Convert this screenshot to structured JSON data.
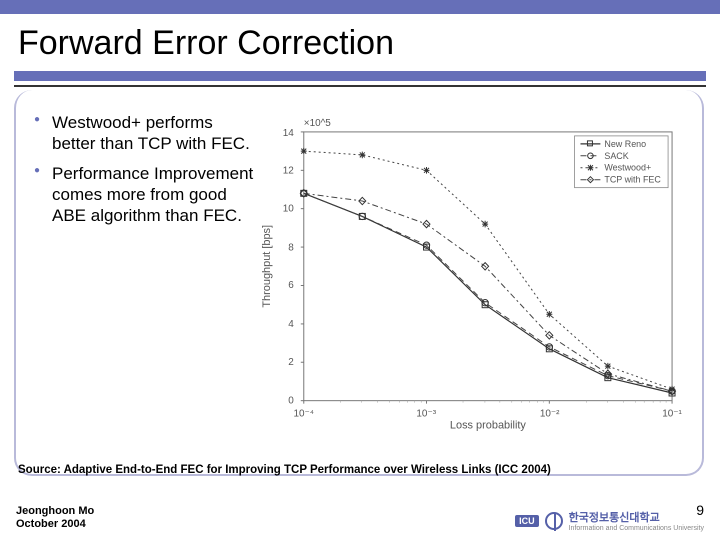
{
  "title": "Forward Error Correction",
  "bullets": [
    "Westwood+ performs better than TCP with FEC.",
    "Performance Improvement comes more from good ABE algorithm than FEC."
  ],
  "source_line": "Source: Adaptive End-to-End FEC for Improving TCP Performance over Wireless Links (ICC 2004)",
  "footer": {
    "author": "Jeonghoon Mo",
    "date": "October 2004",
    "page": "9",
    "uni_kr": "한국정보통신대학교",
    "uni_en": "Information and Communications University",
    "icu": "ICU"
  },
  "chart_data": {
    "type": "line",
    "title": "",
    "xlabel": "Loss probability",
    "ylabel": "Throughput [bps]",
    "x_scale": "log",
    "xlim": [
      0.0001,
      0.1
    ],
    "ylim": [
      0,
      14
    ],
    "y_multiplier_label": "×10^5",
    "x_ticks": [
      0.0001,
      0.001,
      0.01,
      0.1
    ],
    "x_tick_labels": [
      "10^-4",
      "10^-3",
      "10^-2",
      "10^-1"
    ],
    "y_ticks": [
      0,
      2,
      4,
      6,
      8,
      10,
      12,
      14
    ],
    "legend_position": "top-right",
    "series": [
      {
        "name": "New Reno",
        "marker": "square",
        "x": [
          0.0001,
          0.0003,
          0.001,
          0.003,
          0.01,
          0.03,
          0.1
        ],
        "y": [
          10.8,
          9.6,
          8.0,
          5.0,
          2.7,
          1.2,
          0.4
        ]
      },
      {
        "name": "SACK",
        "marker": "circle",
        "x": [
          0.0001,
          0.0003,
          0.001,
          0.003,
          0.01,
          0.03,
          0.1
        ],
        "y": [
          10.8,
          9.6,
          8.1,
          5.1,
          2.8,
          1.3,
          0.5
        ]
      },
      {
        "name": "Westwood+",
        "marker": "star",
        "x": [
          0.0001,
          0.0003,
          0.001,
          0.003,
          0.01,
          0.03,
          0.1
        ],
        "y": [
          13.0,
          12.8,
          12.0,
          9.2,
          4.5,
          1.8,
          0.6
        ]
      },
      {
        "name": "TCP with FEC",
        "marker": "diamond",
        "x": [
          0.0001,
          0.0003,
          0.001,
          0.003,
          0.01,
          0.03,
          0.1
        ],
        "y": [
          10.8,
          10.4,
          9.2,
          7.0,
          3.4,
          1.4,
          0.5
        ]
      }
    ]
  }
}
